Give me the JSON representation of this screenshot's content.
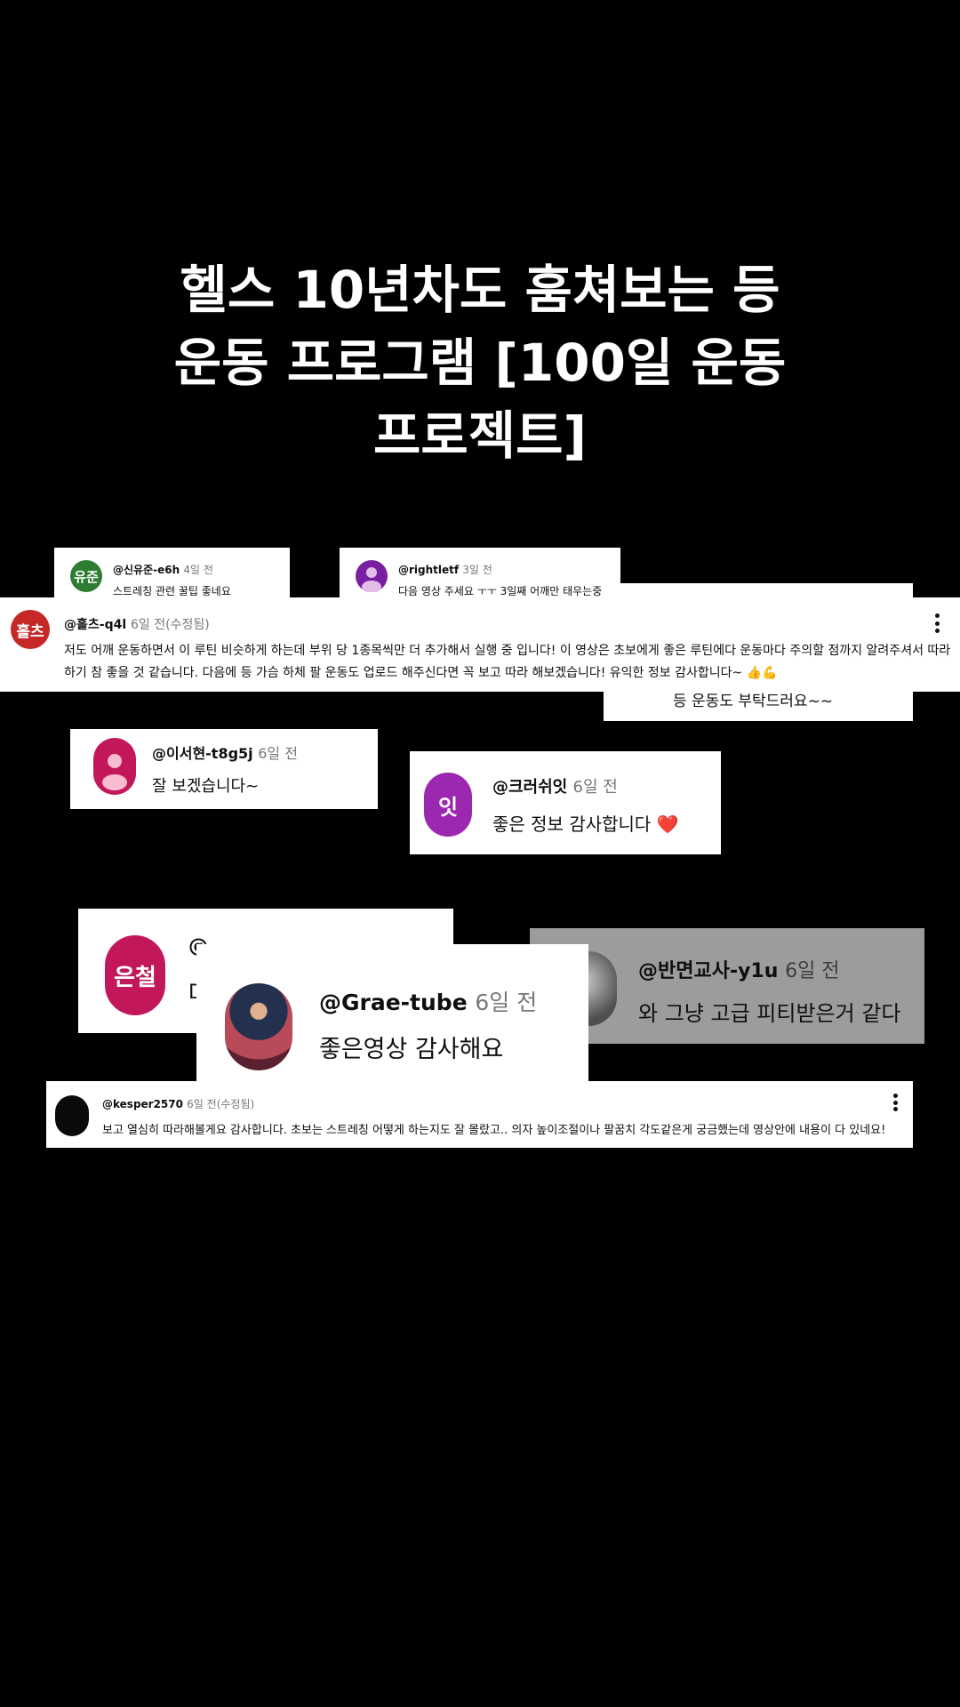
{
  "title": {
    "line1": "헬스 10년차도 훔쳐보는 등",
    "line2": "운동 프로그램 [100일 운동",
    "line3": "프로젝트]"
  },
  "comments": {
    "c1": {
      "initials": "유준",
      "user": "@신유준-e6h",
      "time": "4일 전",
      "text": "스트레칭 관련 꿀팁 좋네요",
      "color": "#2e7d32"
    },
    "c2": {
      "user": "@rightletf",
      "time": "3일 전",
      "text": "다음 영상 주세요 ㅜㅜ 3일째 어깨만 태우는중",
      "color": "#7b1fa2"
    },
    "c3": {
      "text": "등 운동도 부탁드러요~~"
    },
    "c4": {
      "initials": "홀츠",
      "user": "@홀츠-q4l",
      "time": "6일 전(수정됨)",
      "text": "저도 어깨 운동하면서 이 루틴 비슷하게 하는데 부위 당 1종목씩만 더 추가해서 실행 중 입니다! 이 영상은 초보에게 좋은 루틴에다 운동마다 주의할 점까지 알려주셔서 따라하기 참 좋을 것 같습니다. 다음에 등 가슴 하체 팔 운동도 업로드 해주신다면 꼭 보고 따라 해보겠습니다! 유익한 정보 감사합니다~ 👍💪",
      "color": "#c62828"
    },
    "c5": {
      "user": "@이서현-t8g5j",
      "time": "6일 전",
      "text": "잘 보겠습니다~",
      "color": "#c2185b"
    },
    "c6": {
      "initials": "잇",
      "user": "@크러쉬잇",
      "time": "6일 전",
      "text": "좋은 정보 감사합니다 ❤️",
      "color": "#9c27b0"
    },
    "c7": {
      "initials": "은철",
      "user": "@",
      "text": "D",
      "color": "#c2185b"
    },
    "c8": {
      "user": "@반면교사-y1u",
      "time": "6일 전",
      "text": "와 그냥 고급 피티받은거 같다"
    },
    "c9": {
      "user": "@Grae-tube",
      "time": "6일 전",
      "text": "좋은영상 감사해요"
    },
    "c10": {
      "user": "@kesper2570",
      "time": "6일 전(수정됨)",
      "text": "보고 열심히 따라해볼게요 감사합니다. 초보는 스트레칭 어떻게 하는지도 잘 몰랐고.. 의자 높이조절이나 팔꿈치 각도같은게 궁금했는데 영상안에 내용이 다 있네요!"
    }
  }
}
